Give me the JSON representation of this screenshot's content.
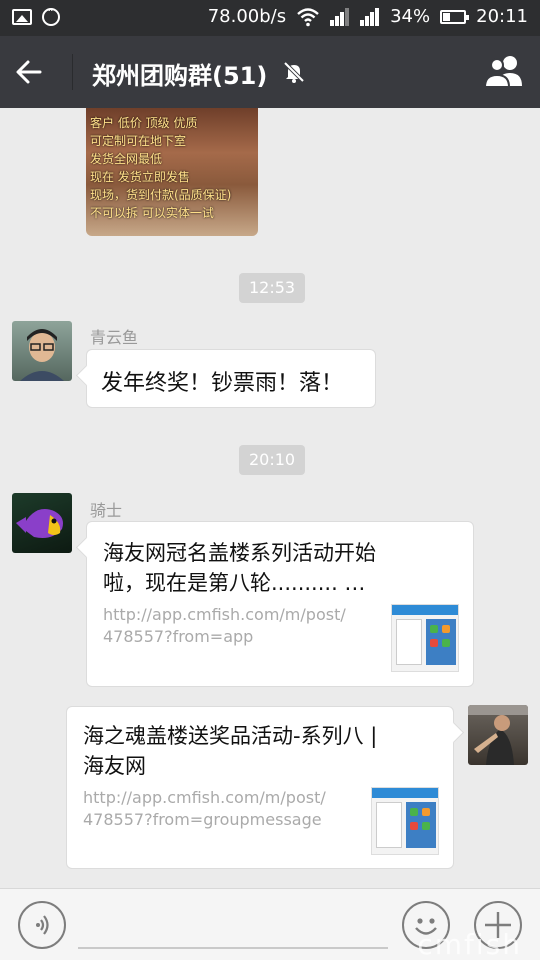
{
  "status_bar": {
    "speed": "78.00b/s",
    "battery_pct": "34%",
    "time": "20:11",
    "battery_level": 0.34,
    "icons": [
      "gallery-icon",
      "chat-bubble-icon",
      "wifi-icon",
      "signal-icon",
      "signal-icon",
      "battery-icon"
    ]
  },
  "header": {
    "title": "郑州团购群(51)",
    "icons": [
      "back-arrow-icon",
      "mute-bell-icon",
      "group-members-icon"
    ]
  },
  "messages": {
    "image_lines": [
      "客户 低价 顶级 优质",
      "可定制可在地下室",
      "发货全网最低",
      "现在  发货立即发售",
      "现场，货到付款(品质保证)",
      "不可以拆 可以实体一试"
    ],
    "time1": "12:53",
    "msg1": {
      "sender": "青云鱼",
      "text": "发年终奖！钞票雨！落！"
    },
    "time2": "20:10",
    "msg2": {
      "sender": "骑士",
      "title_line1": "海友网冠名盖楼系列活动开始",
      "title_line2": "啦，现在是第八轮..........  …",
      "url_line1": "http://app.cmfish.com/m/post/",
      "url_line2": "478557?from=app"
    },
    "msg3": {
      "title_line1": "海之魂盖楼送奖品活动-系列八 |",
      "title_line2": "海友网",
      "url_line1": "http://app.cmfish.com/m/post/",
      "url_line2": "478557?from=groupmessage"
    }
  },
  "input_bar": {
    "icons": [
      "voice-icon",
      "emoji-icon",
      "plus-icon"
    ]
  },
  "watermark": "cmfish"
}
